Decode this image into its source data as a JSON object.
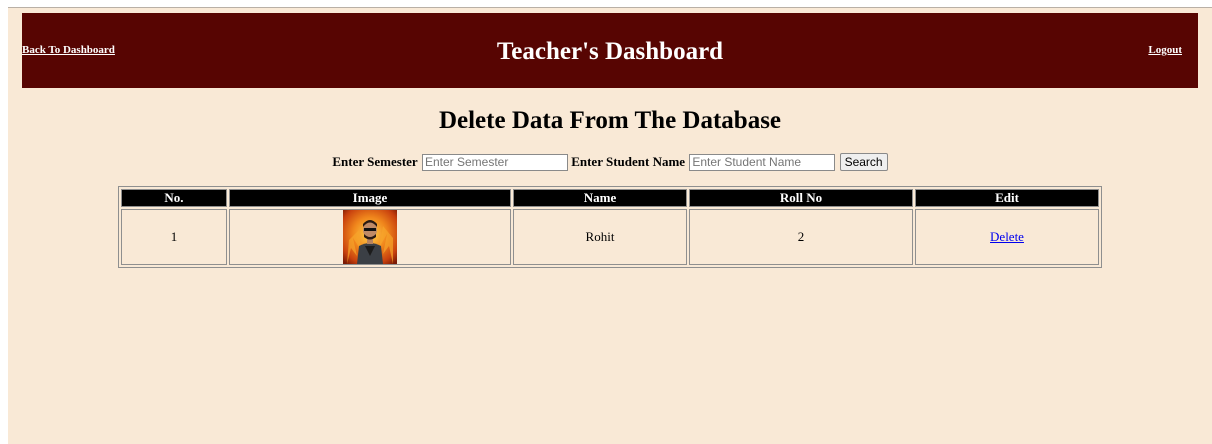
{
  "header": {
    "back_label": "Back To Dashboard",
    "title": "Teacher's Dashboard",
    "logout_label": "Logout"
  },
  "page_title": "Delete Data From The Database",
  "search": {
    "semester_label": "Enter Semester",
    "semester_placeholder": "Enter Semester",
    "name_label": "Enter Student Name",
    "name_placeholder": "Enter Student Name",
    "button_label": "Search"
  },
  "table": {
    "columns": [
      "No.",
      "Image",
      "Name",
      "Roll No",
      "Edit"
    ],
    "rows": [
      {
        "no": "1",
        "name": "Rohit",
        "roll_no": "2",
        "action": "Delete"
      }
    ]
  },
  "colors": {
    "header_bg": "#570502",
    "page_bg": "#f9e9d6",
    "table_header_bg": "#000000",
    "link": "#0000ee"
  }
}
